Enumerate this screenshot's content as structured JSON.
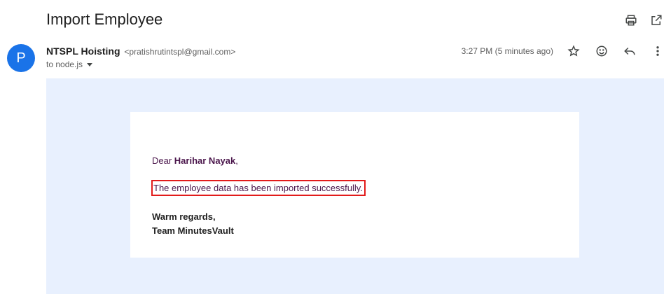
{
  "email": {
    "subject": "Import Employee",
    "sender": {
      "initial": "P",
      "name": "NTSPL Hoisting",
      "email": "<pratishrutintspl@gmail.com>"
    },
    "recipient": "to node.js",
    "timestamp": "3:27 PM (5 minutes ago)"
  },
  "icons": {
    "top": [
      "print-icon",
      "open-in-new-icon"
    ],
    "meta": [
      "star-icon",
      "emoji-icon",
      "reply-icon",
      "more-vert-icon"
    ]
  },
  "body": {
    "greeting_prefix": "Dear ",
    "recipient_name": "Harihar Nayak",
    "greeting_suffix": ",",
    "message": "The employee data has been imported successfully.",
    "signoff_line1": "Warm regards,",
    "signoff_line2": "Team MinutesVault"
  },
  "colors": {
    "avatar": "#1a73e8",
    "panel_bg": "#e8f0fe",
    "highlight_border": "#e21b1b",
    "body_text": "#4a154b"
  }
}
